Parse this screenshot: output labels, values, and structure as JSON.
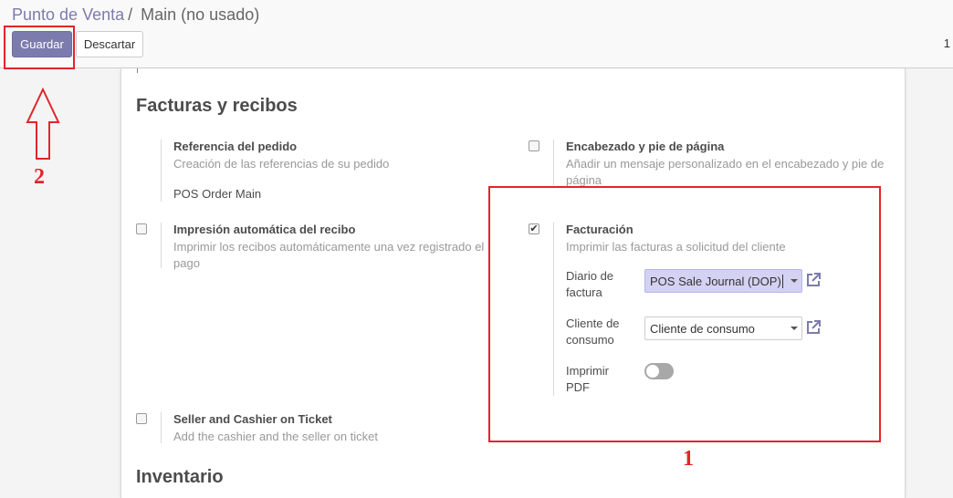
{
  "breadcrumb": {
    "parent": "Punto de Venta",
    "separator": "/",
    "current": "Main (no usado)"
  },
  "toolbar": {
    "save_label": "Guardar",
    "discard_label": "Descartar",
    "pager": "1"
  },
  "sections": {
    "invoices_title": "Facturas y recibos",
    "inventory_title": "Inventario"
  },
  "settings": {
    "order_ref": {
      "title": "Referencia del pedido",
      "desc": "Creación de las referencias de su pedido",
      "value": "POS Order Main"
    },
    "header_footer": {
      "title": "Encabezado y pie de página",
      "desc": "Añadir un mensaje personalizado en el encabezado y pie de página",
      "checked": false
    },
    "auto_print": {
      "title": "Impresión automática del recibo",
      "desc": "Imprimir los recibos automáticamente una vez registrado el pago",
      "checked": false
    },
    "invoicing": {
      "title": "Facturación",
      "desc": "Imprimir las facturas a solicitud del cliente",
      "checked": true,
      "check_mark": "✔",
      "journal_label": "Diario de factura",
      "journal_value": "POS Sale Journal (DOP)",
      "customer_label": "Cliente de consumo",
      "customer_value": "Cliente de consumo",
      "print_pdf_label": "Imprimir PDF",
      "print_pdf_on": false
    },
    "seller_cashier": {
      "title": "Seller and Cashier on Ticket",
      "desc": "Add the cashier and the seller on ticket",
      "checked": false
    }
  },
  "annotations": {
    "box1_number": "1",
    "box2_number": "2",
    "color": "#e0262b"
  },
  "colors": {
    "primary": "#7c7bad",
    "highlight": "#d3d2f3"
  },
  "icons": {
    "external_link": "external-link-icon",
    "dropdown": "caret-down-icon",
    "arrow": "up-arrow-icon"
  }
}
